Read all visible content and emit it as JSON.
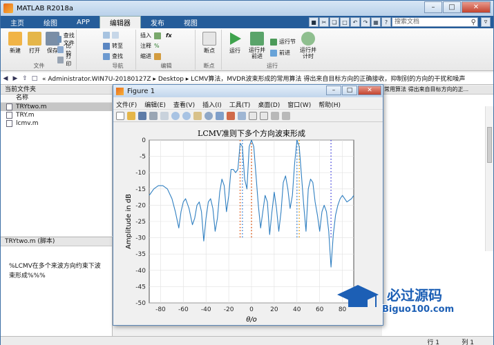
{
  "window": {
    "title": "MATLAB R2018a"
  },
  "ribbon_tabs": [
    "主页",
    "绘图",
    "APP",
    "编辑器",
    "发布",
    "视图"
  ],
  "search": {
    "placeholder": "搜索文档"
  },
  "ribbon": {
    "file": {
      "new": "新建",
      "open": "打开",
      "save": "保存",
      "find_files": "查找文件",
      "compare": "比较",
      "print": "打印",
      "group": "文件"
    },
    "nav": {
      "goto": "转至",
      "find": "查找",
      "group": "导航"
    },
    "edit": {
      "insert": "插入",
      "comment": "注释",
      "indent": "缩进",
      "group": "编辑"
    },
    "breakpoints": {
      "label": "断点",
      "group": "断点"
    },
    "run": {
      "run": "运行",
      "run_advance": "运行并\n前进",
      "run_section": "运行节",
      "advance": "前进",
      "run_time": "运行并\n计时",
      "group": "运行"
    }
  },
  "address": {
    "path": "« Administrator.WIN7U-20180127Z ▸ Desktop ▸ LCMV算法，MVDR波束形成的常用算法 得出来自目标方向的正确接收，抑制别的方向的干扰和噪声"
  },
  "folder_panel": {
    "title": "当前文件夹",
    "column": "名称",
    "files": [
      "TRYtwo.m",
      "TRY.m",
      "lcmv.m"
    ]
  },
  "details_panel": {
    "title": "TRYtwo.m  (脚本)",
    "text": "%LCMV在多个来波方向约束下波束形成%%%"
  },
  "command_panel": {
    "title": "常用算法 得出来自目标方向的正..."
  },
  "status": {
    "line_label": "行  1",
    "col_label": "列  1"
  },
  "figure": {
    "title": "Figure 1",
    "menus": [
      "文件(F)",
      "编辑(E)",
      "查看(V)",
      "插入(I)",
      "工具(T)",
      "桌面(D)",
      "窗口(W)",
      "帮助(H)"
    ]
  },
  "chart_data": {
    "type": "line",
    "title": "LCMV准则下多个方向波束形成",
    "xlabel": "θ/o",
    "ylabel": "Amplitude in dB",
    "xlim": [
      -90,
      90
    ],
    "ylim": [
      -50,
      0
    ],
    "xticks": [
      -80,
      -60,
      -40,
      -20,
      0,
      20,
      40,
      60,
      80
    ],
    "yticks": [
      0,
      -5,
      -10,
      -15,
      -20,
      -25,
      -30,
      -35,
      -40,
      -45,
      -50
    ],
    "grid": true,
    "series": [
      {
        "color": "#2f7fc1",
        "x": [
          -90,
          -86,
          -82,
          -78,
          -74,
          -70,
          -67,
          -64,
          -62,
          -60,
          -58,
          -55,
          -52,
          -50,
          -48,
          -46,
          -44,
          -42,
          -40,
          -38,
          -36,
          -34,
          -32,
          -30,
          -28,
          -26,
          -24,
          -22,
          -20,
          -18,
          -16,
          -14,
          -12,
          -10,
          -8,
          -6,
          -4,
          -2,
          0,
          2,
          4,
          6,
          8,
          10,
          12,
          14,
          16,
          18,
          20,
          22,
          24,
          26,
          28,
          30,
          32,
          34,
          36,
          38,
          40,
          42,
          44,
          46,
          48,
          50,
          52,
          54,
          56,
          58,
          60,
          62,
          64,
          66,
          68,
          70,
          72,
          74,
          76,
          78,
          80,
          84,
          88,
          90
        ],
        "y": [
          -17,
          -15,
          -14,
          -14,
          -15,
          -18,
          -22,
          -27,
          -22,
          -19,
          -18,
          -21,
          -26,
          -24,
          -20,
          -19,
          -22,
          -31,
          -24,
          -19,
          -18,
          -21,
          -28,
          -24,
          -16,
          -12,
          -14,
          -22,
          -17,
          -9,
          -9,
          -10,
          -9,
          -1,
          -2,
          -12,
          -15,
          -2,
          0,
          -2,
          -11,
          -20,
          -27,
          -22,
          -17,
          -19,
          -29,
          -22,
          -16,
          -21,
          -28,
          -22,
          -13,
          -11,
          -15,
          -21,
          -17,
          -7,
          0,
          -2,
          -11,
          -20,
          -28,
          -15,
          -12,
          -13,
          -19,
          -23,
          -28,
          -22,
          -20,
          -22,
          -28,
          -39,
          -29,
          -23,
          -20,
          -18,
          -17,
          -19,
          -18,
          -17
        ]
      }
    ],
    "markers": [
      {
        "x": -10,
        "color": "#e06020"
      },
      {
        "x": -8,
        "color": "#4a8bd8"
      },
      {
        "x": 0,
        "color": "#e06020"
      },
      {
        "x": 40,
        "color": "#4a8bd8"
      },
      {
        "x": 42,
        "color": "#e0a020"
      },
      {
        "x": 70,
        "color": "#5a5ae0"
      }
    ]
  },
  "watermark": {
    "text": "必过源码",
    "url": "Biguo100.com"
  }
}
